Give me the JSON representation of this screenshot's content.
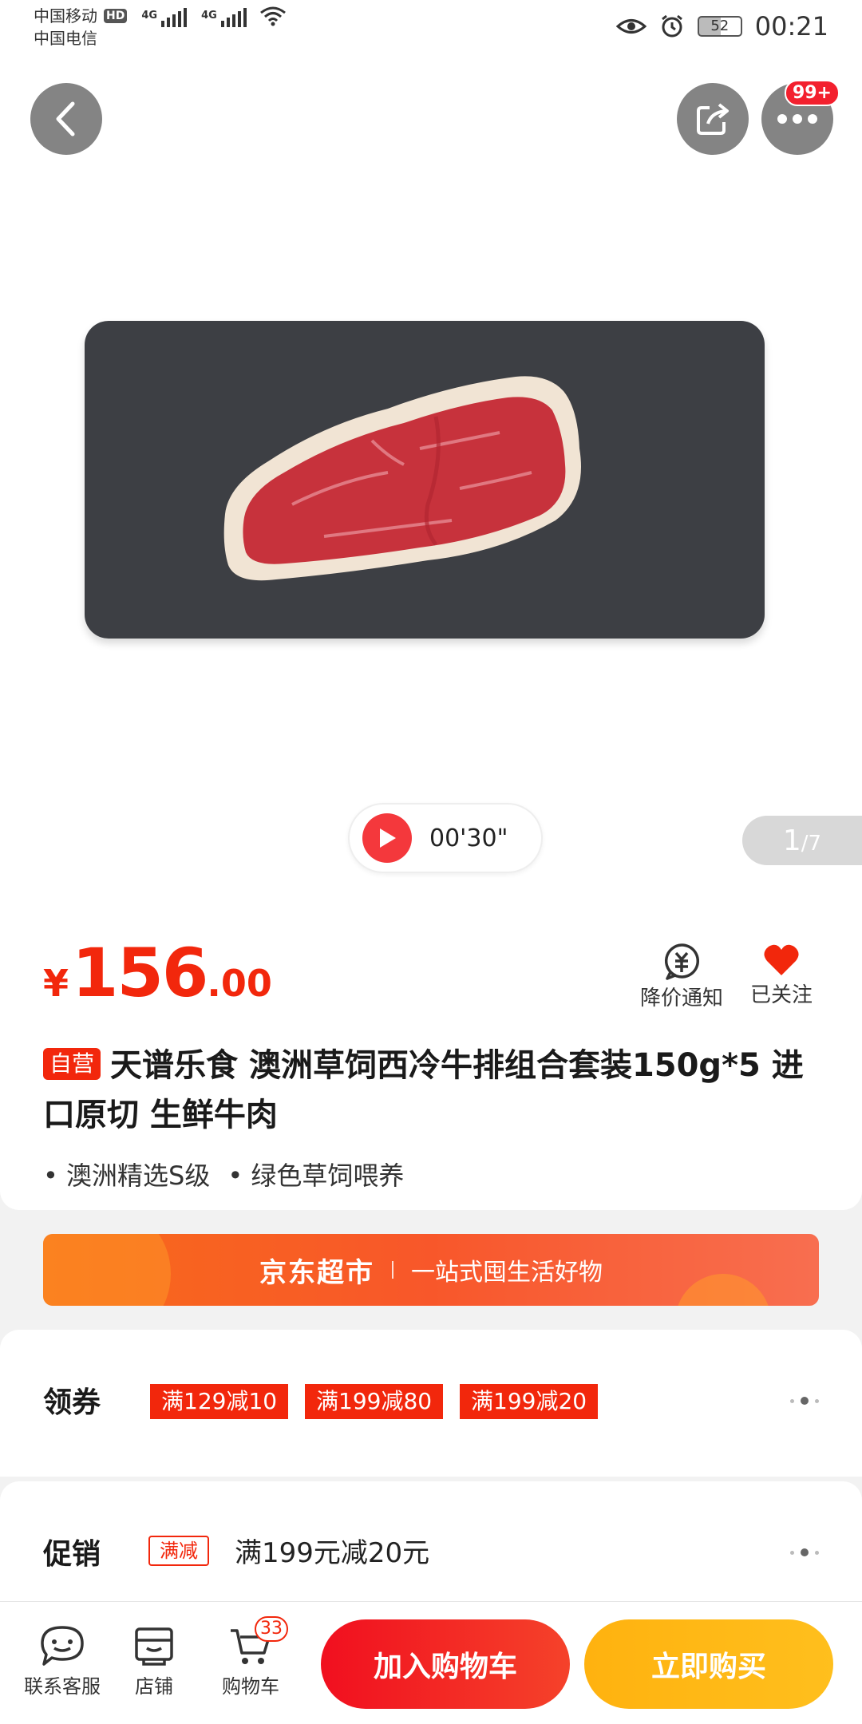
{
  "status_bar": {
    "carrier1": "中国移动",
    "hd": "HD",
    "carrier2": "中国电信",
    "network": "4G",
    "battery": "52",
    "time": "00:21"
  },
  "header": {
    "more_badge": "99+",
    "icons": [
      "back-icon",
      "share-icon",
      "more-icon"
    ]
  },
  "media": {
    "video_duration": "00'30\"",
    "pager_current": "1",
    "pager_total": "/7"
  },
  "product": {
    "price_symbol": "¥",
    "price_int": "156",
    "price_dec": ".00",
    "price_alert_label": "降价通知",
    "follow_label": "已关注",
    "self_run_tag": "自营",
    "title": "天谱乐食  澳洲草饲西冷牛排组合套装150g*5  进口原切  生鲜牛肉",
    "features": [
      "• 澳洲精选S级",
      "• 绿色草饲喂养"
    ]
  },
  "banner": {
    "brand": "京东超市",
    "slogan": "一站式囤生活好物"
  },
  "coupons": {
    "label": "领券",
    "items": [
      "满129减10",
      "满199减80",
      "满199减20"
    ]
  },
  "promotion": {
    "label": "促销",
    "tag": "满减",
    "text": "满199元减20元"
  },
  "bottom_bar": {
    "service_label": "联系客服",
    "shop_label": "店铺",
    "cart_label": "购物车",
    "cart_count": "33",
    "add_to_cart": "加入购物车",
    "buy_now": "立即购买"
  },
  "colors": {
    "accent_red": "#f2270c",
    "buy_yellow": "#ffb20f",
    "banner_orange": "#f86a1a"
  }
}
